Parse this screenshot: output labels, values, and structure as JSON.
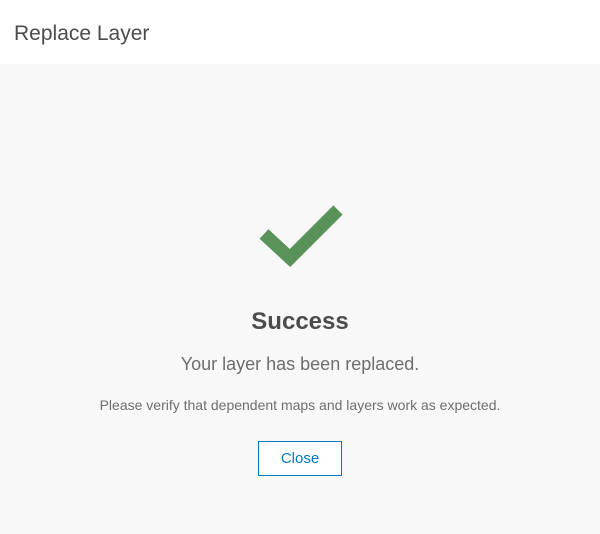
{
  "dialog": {
    "title": "Replace Layer"
  },
  "success": {
    "icon": "checkmark-icon",
    "heading": "Success",
    "message": "Your layer has been replaced.",
    "verify": "Please verify that dependent maps and layers work as expected.",
    "close_label": "Close"
  },
  "colors": {
    "accent": "#0079c1",
    "check": "#5a9359"
  }
}
